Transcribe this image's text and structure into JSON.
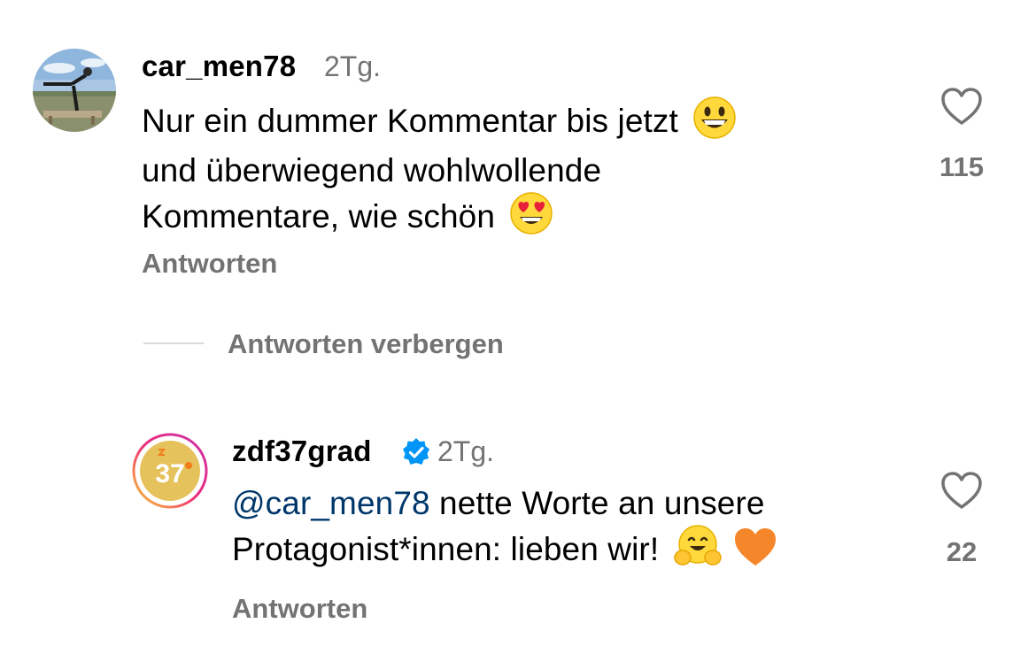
{
  "comments": [
    {
      "username": "car_men78",
      "time": "2Tg.",
      "lines": [
        "Nur ein dummer Kommentar bis jetzt",
        "und überwiegend wohlwollende",
        "Kommentare, wie schön"
      ],
      "emojis": [
        "grinning-face",
        "heart-eyes-face"
      ],
      "like_count": "115",
      "reply_label": "Antworten",
      "avatar_icon": "profile-photo"
    },
    {
      "username": "zdf37grad",
      "time": "2Tg.",
      "verified": true,
      "mention": "@car_men78",
      "line1_rest": " nette Worte an unsere",
      "line2": "Protagonist*innen: lieben wir!",
      "emojis": [
        "hugging-face",
        "orange-heart"
      ],
      "like_count": "22",
      "reply_label": "Antworten",
      "avatar_badge": "37"
    }
  ],
  "hide_replies_label": "Antworten verbergen",
  "colors": {
    "secondary_text": "#737373",
    "mention": "#00376b",
    "verified": "#0095f6"
  }
}
